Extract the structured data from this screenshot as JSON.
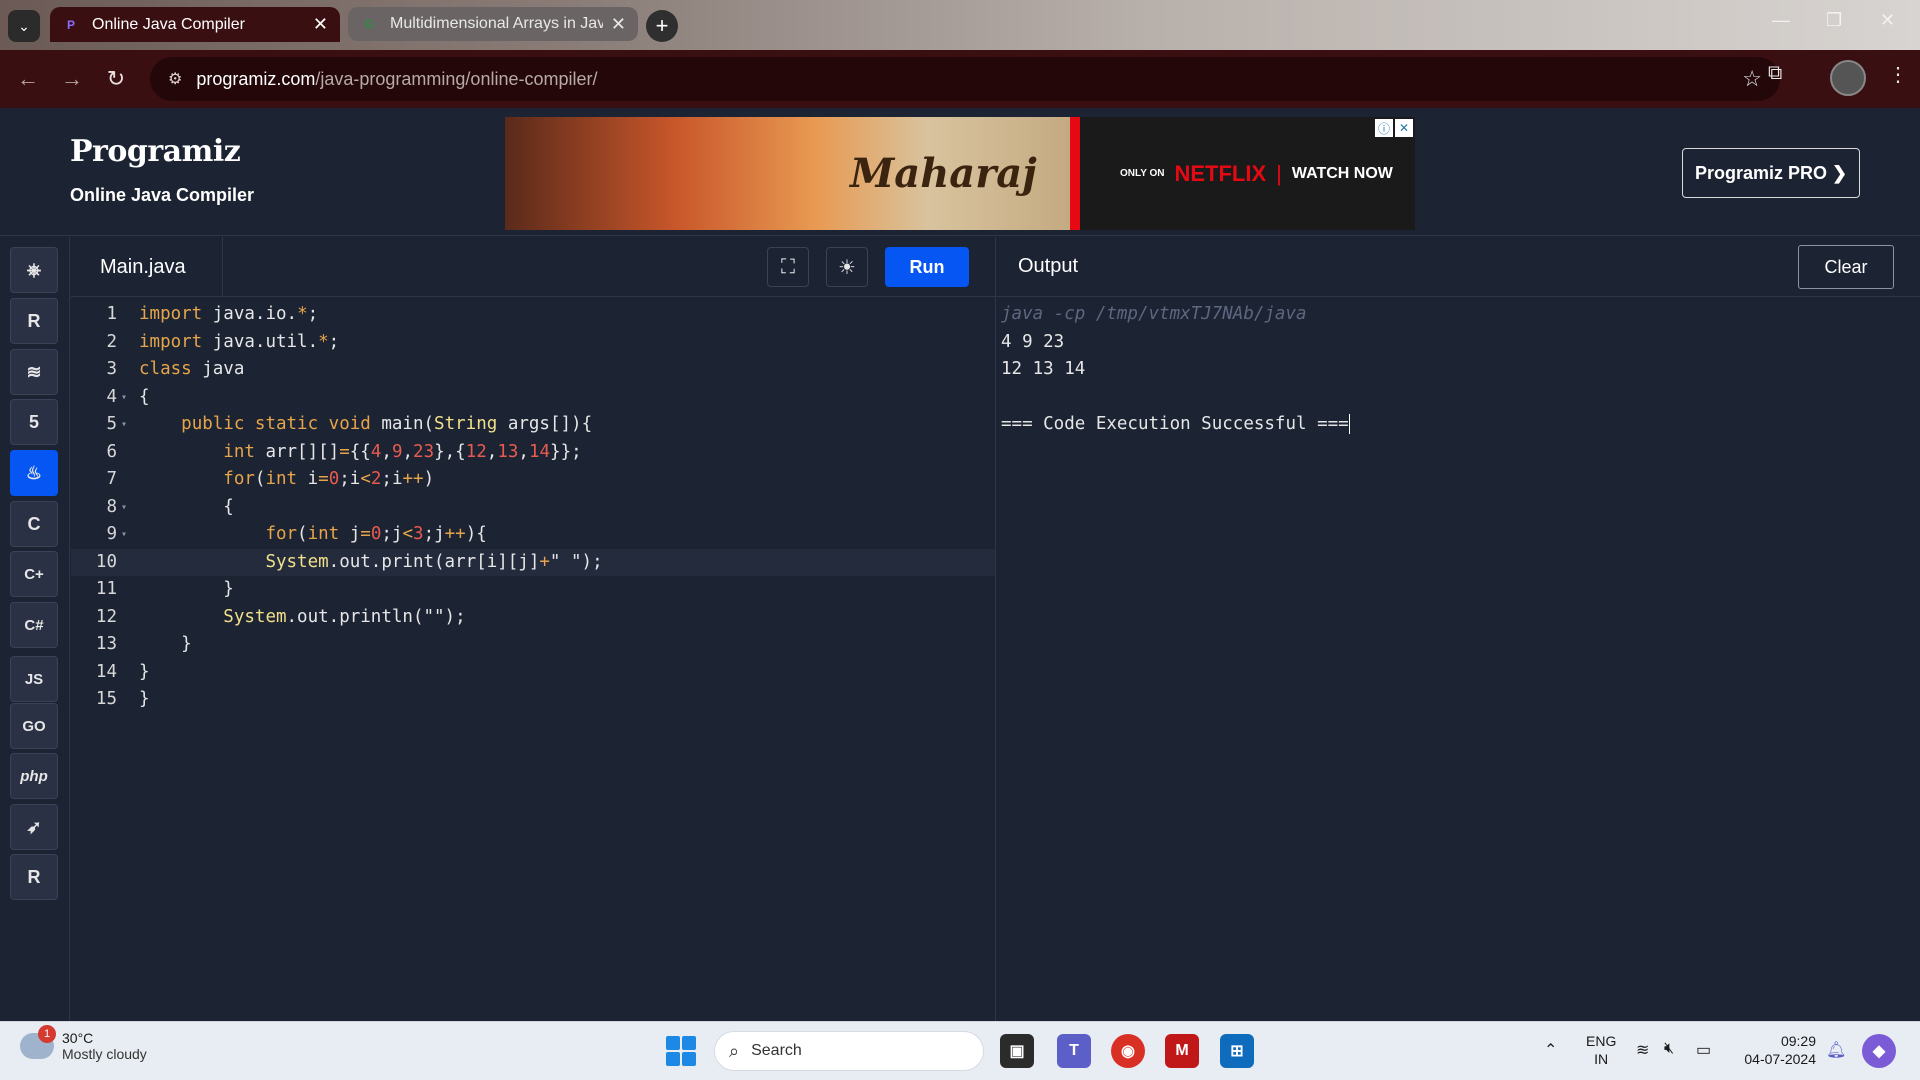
{
  "browser": {
    "tabs": [
      {
        "title": "Online Java Compiler",
        "active": true
      },
      {
        "title": "Multidimensional Arrays in Java",
        "active": false
      }
    ],
    "url_host": "programiz.com",
    "url_path": "/java-programming/online-compiler/"
  },
  "header": {
    "logo": "Programiz",
    "subtitle": "Online Java Compiler",
    "pro_button": "Programiz PRO ❯",
    "ad": {
      "title": "Maharaj",
      "only_on": "ONLY ON",
      "brand": "NETFLIX",
      "separator": "|",
      "cta": "WATCH NOW"
    }
  },
  "rail": {
    "items": [
      {
        "name": "python",
        "glyph": "⎈"
      },
      {
        "name": "r",
        "glyph": "R"
      },
      {
        "name": "sql",
        "glyph": "≋"
      },
      {
        "name": "html",
        "glyph": "5"
      },
      {
        "name": "java",
        "glyph": "♨",
        "active": true
      },
      {
        "name": "c",
        "glyph": "C"
      },
      {
        "name": "cpp",
        "glyph": "C+"
      },
      {
        "name": "csharp",
        "glyph": "C#"
      },
      {
        "name": "js",
        "glyph": "JS"
      },
      {
        "name": "go",
        "glyph": "GO"
      },
      {
        "name": "php",
        "glyph": "php"
      },
      {
        "name": "swift",
        "glyph": "➶"
      },
      {
        "name": "rust",
        "glyph": "R"
      }
    ]
  },
  "editor": {
    "file_name": "Main.java",
    "run_label": "Run",
    "line_numbers": [
      "1",
      "2",
      "3",
      "4",
      "5",
      "6",
      "7",
      "8",
      "9",
      "10",
      "11",
      "12",
      "13",
      "14",
      "15"
    ],
    "current_line": 10
  },
  "output": {
    "title": "Output",
    "clear_label": "Clear",
    "lines": [
      "java -cp /tmp/vtmxTJ7NAb/java",
      "4 9 23",
      "12 13 14",
      "",
      "=== Code Execution Successful ==="
    ]
  },
  "taskbar": {
    "weather_temp": "30°C",
    "weather_cond": "Mostly cloudy",
    "weather_badge": "1",
    "search_label": "Search",
    "lang_top": "ENG",
    "lang_bottom": "IN",
    "time": "09:29",
    "date": "04-07-2024"
  }
}
